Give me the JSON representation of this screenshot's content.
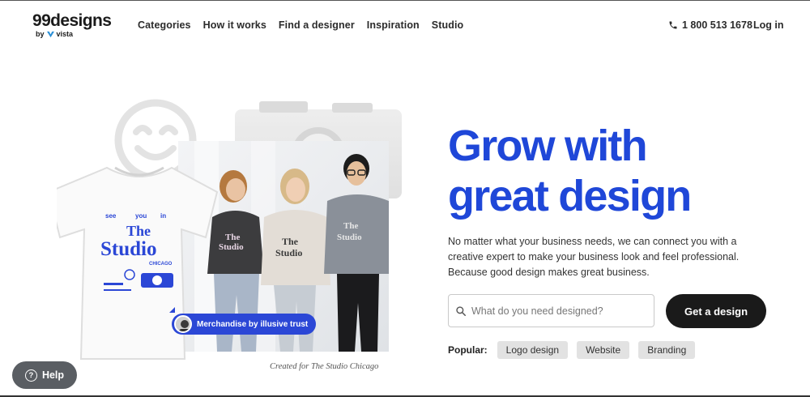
{
  "header": {
    "logo": {
      "name": "99designs",
      "by": "by",
      "brand": "vista"
    },
    "nav": [
      {
        "label": "Categories"
      },
      {
        "label": "How it works"
      },
      {
        "label": "Find a designer"
      },
      {
        "label": "Inspiration"
      },
      {
        "label": "Studio"
      }
    ],
    "phone": "1 800 513 1678",
    "login": "Log in"
  },
  "hero": {
    "headline_line1": "Grow with",
    "headline_line2": "great design",
    "subcopy": "No matter what your business needs, we can connect you with a creative expert to make your business look and feel professional. Because good design makes great business.",
    "search_placeholder": "What do you need designed?",
    "cta": "Get a design",
    "popular_label": "Popular:",
    "popular": [
      {
        "label": "Logo design"
      },
      {
        "label": "Website"
      },
      {
        "label": "Branding"
      }
    ]
  },
  "collage": {
    "badge": "Merchandise by illusive trust",
    "caption": "Created for The Studio Chicago",
    "tshirt_text": {
      "see": "see",
      "you": "you",
      "in": "in",
      "the": "The",
      "studio": "Studio",
      "city": "CHICAGO"
    }
  },
  "help": {
    "label": "Help"
  },
  "colors": {
    "brand_blue": "#1f47d8",
    "cta_dark": "#1a1a1a",
    "chip_bg": "#e2e2e2",
    "help_bg": "#5a5e63"
  }
}
